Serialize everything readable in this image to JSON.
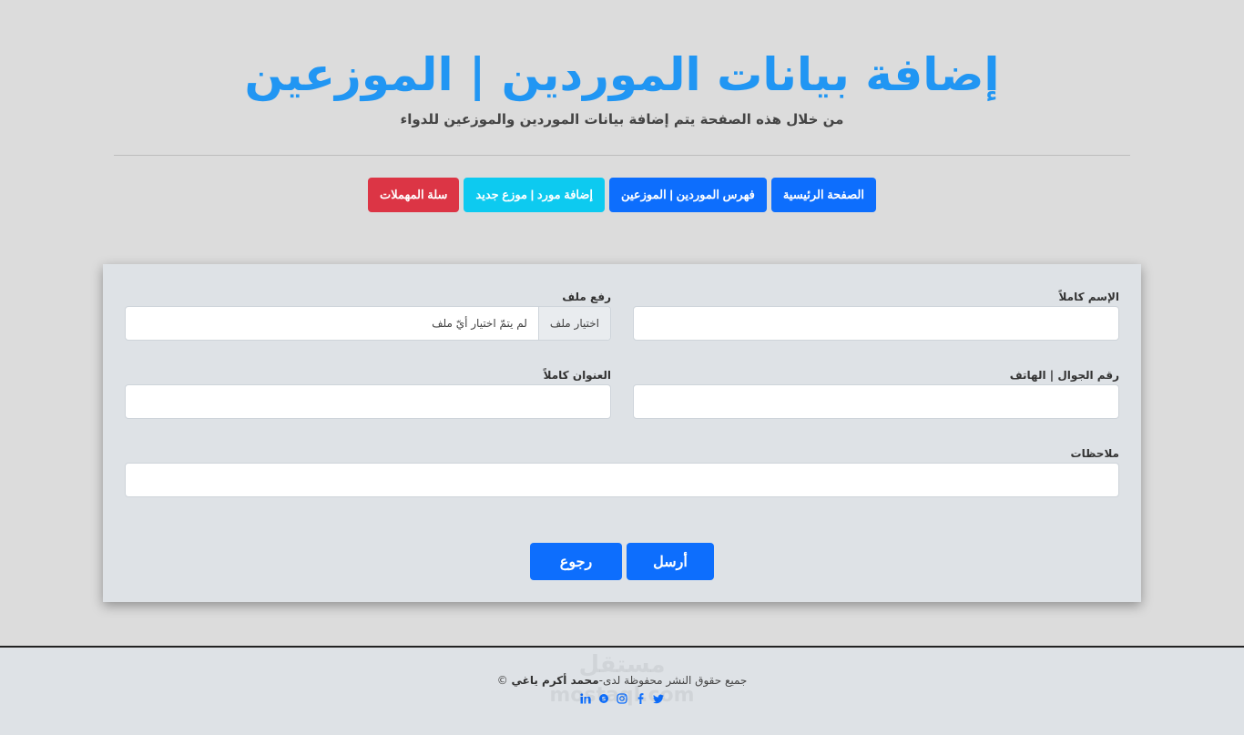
{
  "header": {
    "title": "إضافة بيانات الموردين | الموزعين",
    "subtitle": "من خلال هذه الصفحة يتم إضافة بيانات الموردين والموزعين للدواء"
  },
  "nav": {
    "home": "الصفحة الرئيسية",
    "index": "فهرس الموردين | الموزعين",
    "add_new": "إضافة مورد | موزع جديد",
    "trash": "سلة المهملات"
  },
  "form": {
    "full_name_label": "الإسم كاملاً",
    "full_name_value": "",
    "upload_label": "رفع ملف",
    "file_button": "اختيار ملف",
    "file_status": "لم يتمّ اختيار أيّ ملف",
    "phone_label": "رقم الجوال | الهاتف",
    "phone_value": "",
    "address_label": "العنوان كاملاً",
    "address_value": "",
    "notes_label": "ملاحظات",
    "notes_value": "",
    "submit": "أرسل",
    "back": "رجوع"
  },
  "footer": {
    "copyright_prefix": "جميع حقوق النشر محفوظة لدى-",
    "author": "محمد أكرم ياغي",
    "symbol": "©",
    "watermark_ar": "مستقل",
    "watermark_en": "mostaql.com"
  },
  "social_icons": [
    "twitter-icon",
    "facebook-icon",
    "instagram-icon",
    "skype-icon",
    "linkedin-icon"
  ],
  "colors": {
    "title": "#2196f3",
    "primary": "#0d6efd",
    "info": "#0dcaf0",
    "danger": "#dc3545"
  }
}
